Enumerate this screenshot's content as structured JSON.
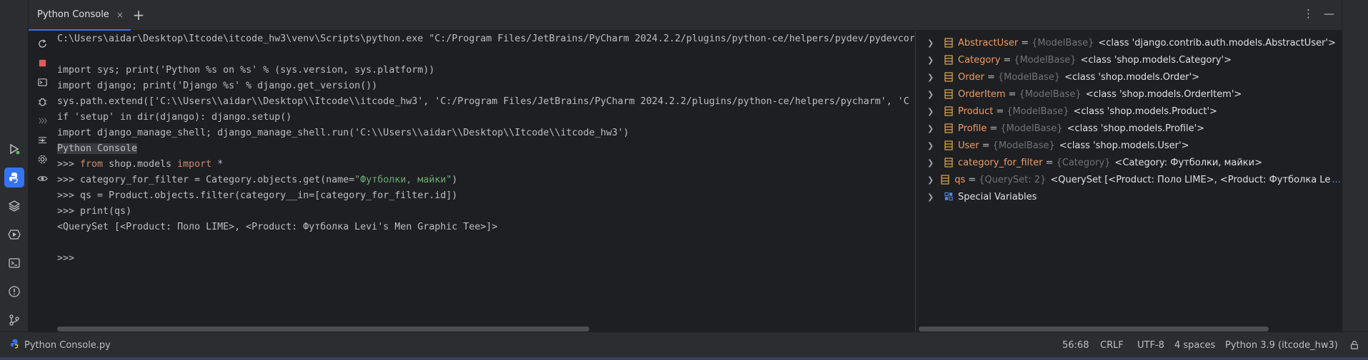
{
  "tab": {
    "title": "Python Console",
    "close_glyph": "×",
    "add_glyph": "+"
  },
  "tab_actions": {
    "more_glyph": "⋮",
    "minimize_glyph": "—"
  },
  "console": {
    "lines": [
      {
        "text": "C:\\Users\\aidar\\Desktop\\Itcode\\itcode_hw3\\venv\\Scripts\\python.exe \"C:/Program Files/JetBrains/PyCharm 2024.2.2/plugins/python-ce/helpers/pydev/pydevcor"
      },
      {
        "text": ""
      },
      {
        "text": "import sys; print('Python %s on %s' % (sys.version, sys.platform))"
      },
      {
        "text": "import django; print('Django %s' % django.get_version())"
      },
      {
        "text": "sys.path.extend(['C:\\\\Users\\\\aidar\\\\Desktop\\\\Itcode\\\\itcode_hw3', 'C:/Program Files/JetBrains/PyCharm 2024.2.2/plugins/python-ce/helpers/pycharm', 'C"
      },
      {
        "text": "if 'setup' in dir(django): django.setup()"
      },
      {
        "text": "import django_manage_shell; django_manage_shell.run('C:\\\\Users\\\\aidar\\\\Desktop\\\\Itcode\\\\itcode_hw3')"
      },
      {
        "text": "Python Console"
      },
      {
        "prompt": ">>> ",
        "kw1": "from",
        "mid": " shop.models ",
        "kw2": "import",
        "rest": " *"
      },
      {
        "prompt": ">>> ",
        "pre": "category_for_filter = Category.objects.get(name=",
        "str": "\"Футболки, майки\"",
        "post": ")"
      },
      {
        "text": ">>> qs = Product.objects.filter(category__in=[category_for_filter.id])"
      },
      {
        "text": ">>> print(qs)"
      },
      {
        "text": "<QuerySet [<Product: Поло LIME>, <Product: Футболка Levi's Men Graphic Tee>]>"
      },
      {
        "text": ""
      },
      {
        "text": ">>>"
      }
    ]
  },
  "variables": [
    {
      "name": "AbstractUser",
      "type": "{ModelBase}",
      "value": "<class 'django.contrib.auth.models.AbstractUser'>"
    },
    {
      "name": "Category",
      "type": "{ModelBase}",
      "value": "<class 'shop.models.Category'>"
    },
    {
      "name": "Order",
      "type": "{ModelBase}",
      "value": "<class 'shop.models.Order'>"
    },
    {
      "name": "OrderItem",
      "type": "{ModelBase}",
      "value": "<class 'shop.models.OrderItem'>"
    },
    {
      "name": "Product",
      "type": "{ModelBase}",
      "value": "<class 'shop.models.Product'>"
    },
    {
      "name": "Profile",
      "type": "{ModelBase}",
      "value": "<class 'shop.models.Profile'>"
    },
    {
      "name": "User",
      "type": "{ModelBase}",
      "value": "<class 'shop.models.User'>"
    },
    {
      "name": "category_for_filter",
      "type": "{Category}",
      "value": "<Category: Футболки, майки>"
    },
    {
      "name": "qs",
      "type": "{QuerySet: 2}",
      "value": "<QuerySet [<Product: Поло LIME>, <Product: Футболка Le",
      "link": "... View"
    }
  ],
  "special_variables": "Special Variables",
  "status": {
    "file": "Python Console.py",
    "position": "56:68",
    "line_sep": "CRLF",
    "encoding": "UTF-8",
    "indent": "4 spaces",
    "interpreter": "Python 3.9 (itcode_hw3)"
  },
  "colors": {
    "accent": "#3574f0",
    "keyword": "#cf8e6d",
    "string": "#6aab73",
    "var_name": "#ed9c6a",
    "link": "#548af7"
  }
}
